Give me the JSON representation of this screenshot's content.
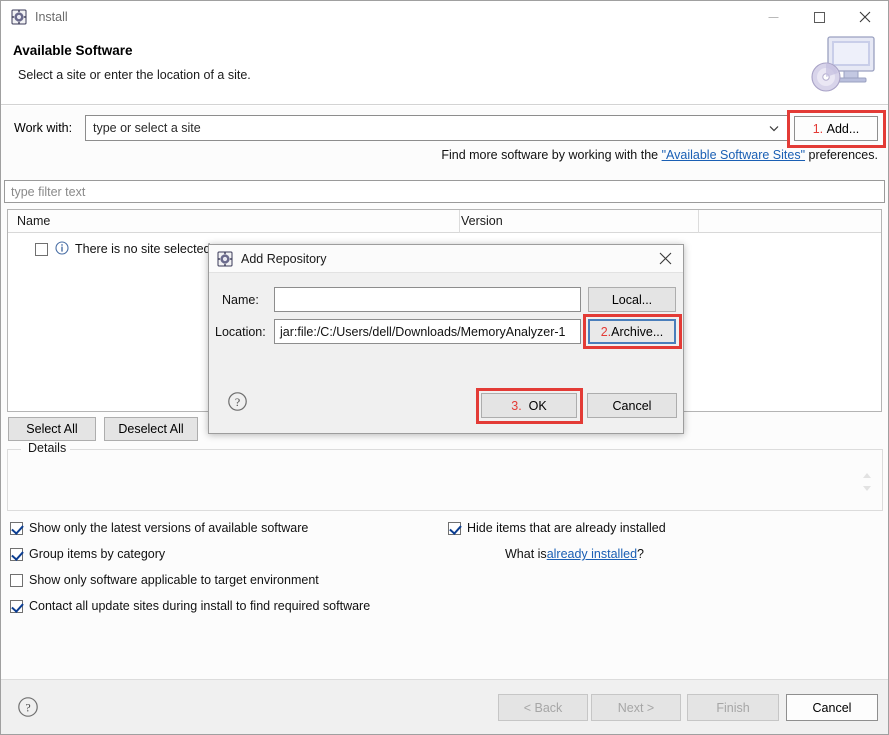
{
  "window": {
    "title": "Install",
    "app_icon": "install-gear-icon",
    "controls": {
      "minimize": "minimize-icon",
      "maximize": "maximize-icon",
      "close": "close-icon"
    }
  },
  "header": {
    "title": "Available Software",
    "subtitle": "Select a site or enter the location of a site.",
    "graphic": "monitor-cd-icon"
  },
  "work_with": {
    "label": "Work with:",
    "value": "type or select a site",
    "placeholder": "type or select a site",
    "dropdown_icon": "chevron-down-icon",
    "add_button": {
      "label_number": "1.",
      "label_text": "Add...",
      "annotated": true
    }
  },
  "find_more": {
    "prefix": "Find more software by working with the ",
    "link": "\"Available Software Sites\"",
    "suffix": " preferences."
  },
  "filter": {
    "placeholder": "type filter text",
    "value": ""
  },
  "tree": {
    "columns": [
      "Name",
      "Version"
    ],
    "rows": [
      {
        "checked": false,
        "icon": "info-icon",
        "label": "There is no site selected",
        "version": ""
      }
    ]
  },
  "tree_buttons": {
    "select_all": "Select All",
    "deselect_all": "Deselect All"
  },
  "details": {
    "legend": "Details",
    "content": "",
    "scroll_icon": "spinner-arrows-icon"
  },
  "options": {
    "left": [
      {
        "label": "Show only the latest versions of available software",
        "checked": true
      },
      {
        "label": "Group items by category",
        "checked": true
      },
      {
        "label": "Show only software applicable to target environment",
        "checked": false
      },
      {
        "label": "Contact all update sites during install to find required software",
        "checked": true
      }
    ],
    "right": [
      {
        "label": "Hide items that are already installed",
        "checked": true
      }
    ],
    "what_is": {
      "prefix": "What is ",
      "link": "already installed",
      "suffix": "?"
    }
  },
  "footer": {
    "help_icon": "help-question-icon",
    "buttons": [
      {
        "label": "< Back",
        "enabled": false
      },
      {
        "label": "Next >",
        "enabled": false
      },
      {
        "label": "Finish",
        "enabled": false
      },
      {
        "label": "Cancel",
        "enabled": true
      }
    ]
  },
  "modal": {
    "title": "Add Repository",
    "icon": "install-gear-icon",
    "close_icon": "close-icon",
    "name_label": "Name:",
    "name_value": "",
    "location_label": "Location:",
    "location_value": "jar:file:/C:/Users/dell/Downloads/MemoryAnalyzer-1",
    "local_button": "Local...",
    "archive_button": {
      "label_number": "2.",
      "label_text": "Archive...",
      "annotated": true,
      "focused": true
    },
    "ok_button": {
      "label_number": "3.",
      "label_text": "OK",
      "annotated": true
    },
    "cancel_button": "Cancel",
    "help_icon": "help-question-icon"
  },
  "colors": {
    "annotation_red": "#e33b36",
    "link_blue": "#1a5fb4",
    "focus_blue": "#4a7ebb",
    "title_grey": "#6b6b6b"
  }
}
